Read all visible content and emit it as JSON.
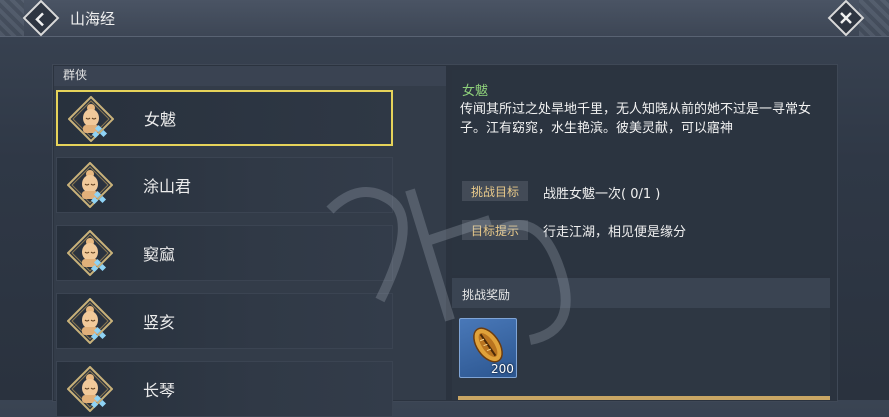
{
  "header": {
    "title": "山海经"
  },
  "list": {
    "header": "群侠",
    "items": [
      {
        "name": "女魃",
        "selected": true
      },
      {
        "name": "涂山君",
        "selected": false
      },
      {
        "name": "窫窳",
        "selected": false
      },
      {
        "name": "竖亥",
        "selected": false
      },
      {
        "name": "长琴",
        "selected": false
      }
    ]
  },
  "detail": {
    "name": "女魃",
    "description": "传闻其所过之处旱地千里，无人知晓从前的她不过是一寻常女子。江有窈窕，水生艳滨。彼美灵献，可以寤神",
    "challenge_label": "挑战目标",
    "challenge_text": "战胜女魃一次( 0/1 )",
    "hint_label": "目标提示",
    "hint_text": "行走江湖，相见便是缘分"
  },
  "reward": {
    "header": "挑战奖励",
    "item_icon": "shell-coin-icon",
    "count": "200"
  },
  "colors": {
    "selected_border": "#e6d35a",
    "hero_name_green": "#8ed07a",
    "tag_text": "#e8c98a",
    "reward_bg": "#4978b8"
  }
}
